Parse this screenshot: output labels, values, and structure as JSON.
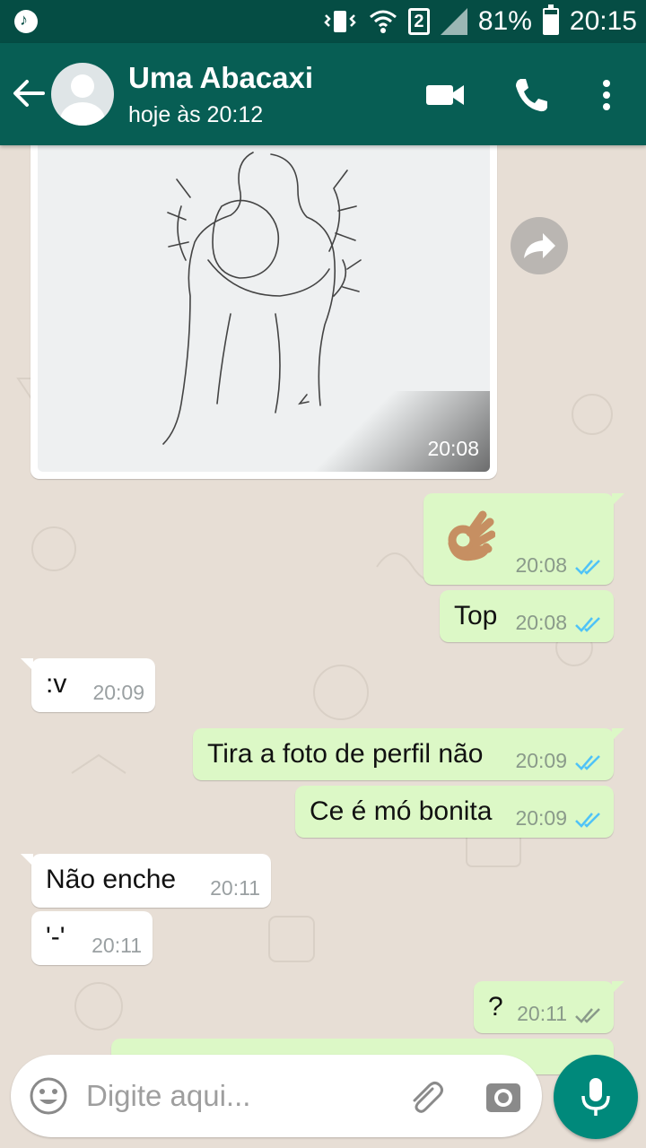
{
  "status_bar": {
    "battery": "81%",
    "time": "20:15",
    "sim": "2"
  },
  "header": {
    "name": "Uma Abacaxi",
    "last_seen": "hoje às 20:12"
  },
  "image_message": {
    "time": "20:08"
  },
  "messages": [
    {
      "dir": "out",
      "text": "👌",
      "time": "20:08",
      "read": true
    },
    {
      "dir": "out",
      "text": "Top",
      "time": "20:08",
      "read": true
    },
    {
      "dir": "in",
      "text": ":v",
      "time": "20:09"
    },
    {
      "dir": "out",
      "text": "Tira a foto de perfil não",
      "time": "20:09",
      "read": true
    },
    {
      "dir": "out",
      "text": "Ce é mó bonita",
      "time": "20:09",
      "read": true
    },
    {
      "dir": "in",
      "text": "Não enche",
      "time": "20:11"
    },
    {
      "dir": "in",
      "text": "'-'",
      "time": "20:11"
    },
    {
      "dir": "out",
      "text": "?",
      "time": "20:11",
      "read": false
    }
  ],
  "composer": {
    "placeholder": "Digite aqui..."
  },
  "colors": {
    "header": "#075e54",
    "status_bar": "#054d44",
    "outgoing": "#dcf8c6",
    "incoming": "#ffffff",
    "read_ticks": "#4fc3f7",
    "mic": "#00897b"
  }
}
